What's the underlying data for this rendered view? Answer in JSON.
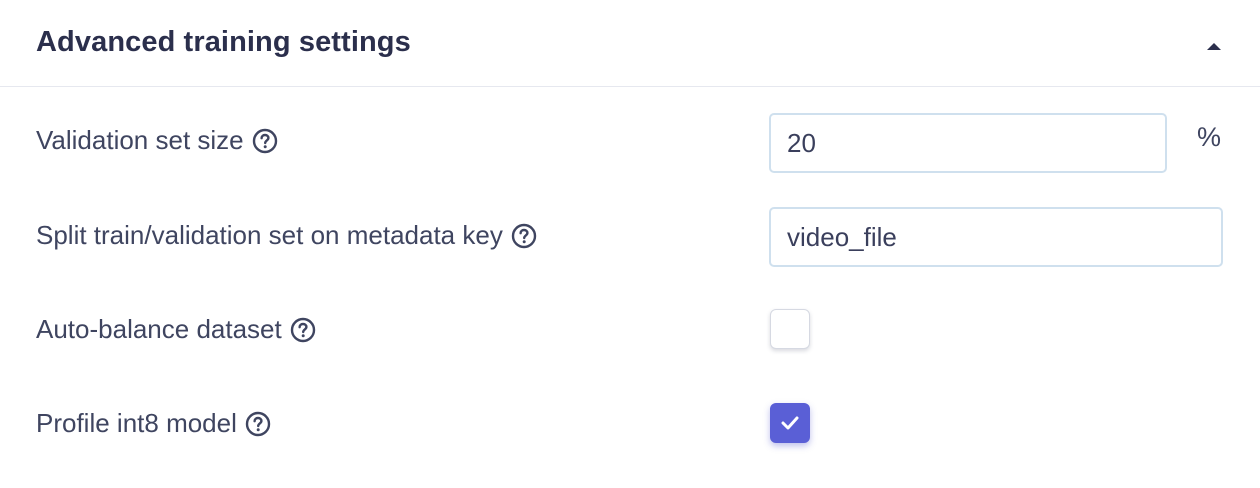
{
  "section": {
    "title": "Advanced training settings",
    "collapse_icon": "caret-up-icon"
  },
  "fields": {
    "validation_size": {
      "label": "Validation set size",
      "value": "20",
      "unit": "%"
    },
    "split_key": {
      "label": "Split train/validation set on metadata key",
      "value": "video_file"
    },
    "auto_balance": {
      "label": "Auto-balance dataset",
      "checked": false
    },
    "profile_int8": {
      "label": "Profile int8 model",
      "checked": true
    }
  },
  "colors": {
    "accent": "#5a5fd6",
    "input_border": "#cfe0ee",
    "text": "#3f4560",
    "title": "#2b2f4c"
  }
}
